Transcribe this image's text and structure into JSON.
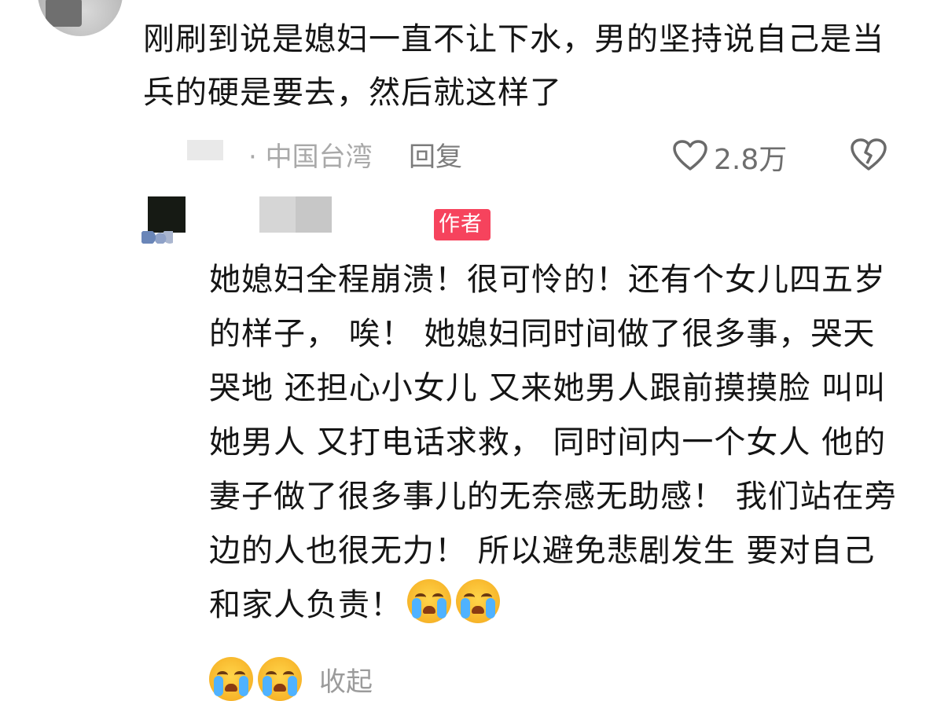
{
  "comment": {
    "text": "刚刷到说是媳妇一直不让下水，男的坚持说自己是当兵的硬是要去，然后就这样了",
    "location": "· 中国台湾",
    "reply_label": "回复",
    "like_count": "2.8万",
    "icons": {
      "like": "heart-outline-icon",
      "dislike": "broken-heart-icon"
    }
  },
  "reply": {
    "badge": "作者",
    "text": "她媳妇全程崩溃！很可怜的！还有个女儿四五岁的样子， 唉！ 她媳妇同时间做了很多事，哭天哭地 还担心小女儿 又来她男人跟前摸摸脸 叫叫她男人 又打电话求救， 同时间内一个女人 他的妻子做了很多事儿的无奈感无助感！ 我们站在旁边的人也很无力！ 所以避免悲剧发生 要对自己和家人负责！",
    "emoji_name": "loudly-crying-face-icon",
    "collapse_label": "收起"
  },
  "colors": {
    "badge_bg": "#f6435d",
    "text": "#151515",
    "meta": "#8a8a8a"
  }
}
